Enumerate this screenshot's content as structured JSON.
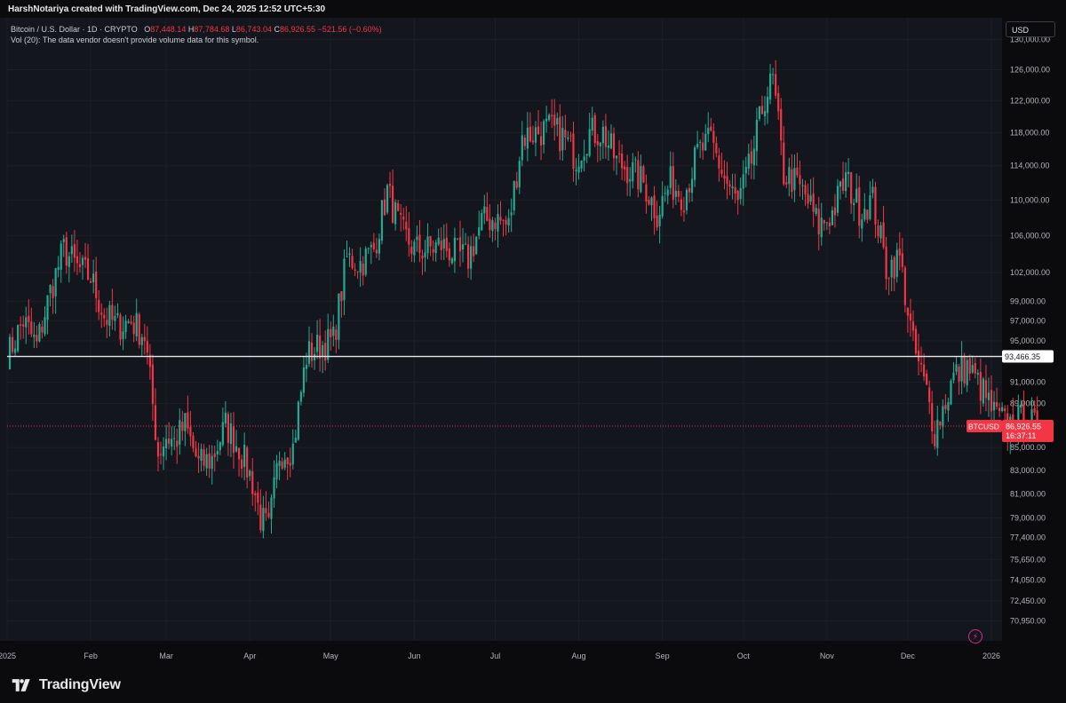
{
  "header": {
    "title": "HarshNotariya created with TradingView.com, Dec 24, 2025 12:52 UTC+5:30"
  },
  "legend": {
    "symbol": "Bitcoin / U.S. Dollar · 1D · CRYPTO",
    "o_label": "O",
    "o_value": "87,448.14",
    "h_label": "H",
    "h_value": "87,784.68",
    "l_label": "L",
    "l_value": "86,743.04",
    "c_label": "C",
    "c_value": "86,926.55",
    "change": "−521.56 (−0.60%)",
    "volume_note": "Vol (20): The data vendor doesn't provide volume data for this symbol."
  },
  "currency": "USD",
  "footer": {
    "brand": "TradingView"
  },
  "colors": {
    "background": "#0b0b0d",
    "up": "#22ab94",
    "down": "#f23645",
    "grid": "#1c1f26",
    "text": "#b2b5be"
  },
  "chart_data": {
    "type": "candlestick",
    "symbol": "BTCUSD",
    "x_axis_labels": [
      "2025",
      "Feb",
      "Mar",
      "Apr",
      "May",
      "Jun",
      "Jul",
      "Aug",
      "Sep",
      "Oct",
      "Nov",
      "Dec",
      "2026"
    ],
    "y_axis_scale": "log",
    "y_ticks": [
      130000,
      126000,
      122000,
      118000,
      114000,
      110000,
      106000,
      102000,
      99000,
      97000,
      95000,
      91000,
      89000,
      85000,
      83000,
      81000,
      79000,
      77400,
      75650,
      74050,
      72450,
      70950
    ],
    "y_tick_labels": [
      "130,000.00",
      "126,000.00",
      "122,000.00",
      "118,000.00",
      "114,000.00",
      "110,000.00",
      "106,000.00",
      "102,000.00",
      "99,000.00",
      "97,000.00",
      "95,000.00",
      "91,000.00",
      "89,000.00",
      "85,000.00",
      "83,000.00",
      "81,000.00",
      "79,000.00",
      "77,400.00",
      "75,650.00",
      "74,050.00",
      "72,450.00",
      "70,950.00"
    ],
    "ylim": [
      69500,
      133000
    ],
    "horizontal_line": {
      "value": 93466.35,
      "label": "93,466.35"
    },
    "last_price": {
      "value": 86926.55,
      "label": "86,926.55",
      "symbol_label": "BTCUSD",
      "countdown": "16:37:11"
    },
    "grid": true,
    "candles_daily_close": [
      [
        1,
        94000
      ],
      [
        6,
        97000
      ],
      [
        11,
        94500
      ],
      [
        16,
        100000
      ],
      [
        21,
        104500
      ],
      [
        26,
        102500
      ],
      [
        31,
        101500
      ],
      [
        36,
        97500
      ],
      [
        41,
        96500
      ],
      [
        46,
        97000
      ],
      [
        51,
        95500
      ],
      [
        56,
        84500
      ],
      [
        59,
        86000
      ],
      [
        62,
        85500
      ],
      [
        66,
        87000
      ],
      [
        71,
        83500
      ],
      [
        76,
        84000
      ],
      [
        81,
        87000
      ],
      [
        86,
        85000
      ],
      [
        91,
        82000
      ],
      [
        94,
        79000
      ],
      [
        97,
        78000
      ],
      [
        101,
        84500
      ],
      [
        106,
        85000
      ],
      [
        111,
        93500
      ],
      [
        116,
        94500
      ],
      [
        121,
        95000
      ],
      [
        126,
        103500
      ],
      [
        131,
        103000
      ],
      [
        136,
        104500
      ],
      [
        141,
        111000
      ],
      [
        146,
        106500
      ],
      [
        151,
        104500
      ],
      [
        156,
        104500
      ],
      [
        161,
        105000
      ],
      [
        166,
        104000
      ],
      [
        171,
        103500
      ],
      [
        176,
        107500
      ],
      [
        181,
        108000
      ],
      [
        186,
        107000
      ],
      [
        191,
        117500
      ],
      [
        196,
        118000
      ],
      [
        201,
        118500
      ],
      [
        206,
        117500
      ],
      [
        211,
        115000
      ],
      [
        216,
        118000
      ],
      [
        221,
        118000
      ],
      [
        226,
        114500
      ],
      [
        231,
        113500
      ],
      [
        236,
        112000
      ],
      [
        241,
        108500
      ],
      [
        246,
        112000
      ],
      [
        251,
        110500
      ],
      [
        256,
        115500
      ],
      [
        261,
        117000
      ],
      [
        266,
        112500
      ],
      [
        271,
        109500
      ],
      [
        276,
        114500
      ],
      [
        281,
        122500
      ],
      [
        284,
        124500
      ],
      [
        288,
        113000
      ],
      [
        291,
        112500
      ],
      [
        296,
        110500
      ],
      [
        301,
        107000
      ],
      [
        306,
        108500
      ],
      [
        311,
        112500
      ],
      [
        316,
        109000
      ],
      [
        321,
        110000
      ],
      [
        326,
        102500
      ],
      [
        331,
        103500
      ],
      [
        336,
        94500
      ],
      [
        341,
        90000
      ],
      [
        344,
        86500
      ],
      [
        347,
        88500
      ],
      [
        351,
        91500
      ],
      [
        356,
        92500
      ],
      [
        361,
        90500
      ],
      [
        366,
        88000
      ],
      [
        371,
        87000
      ],
      [
        376,
        87500
      ],
      [
        382,
        86926.55
      ]
    ]
  }
}
